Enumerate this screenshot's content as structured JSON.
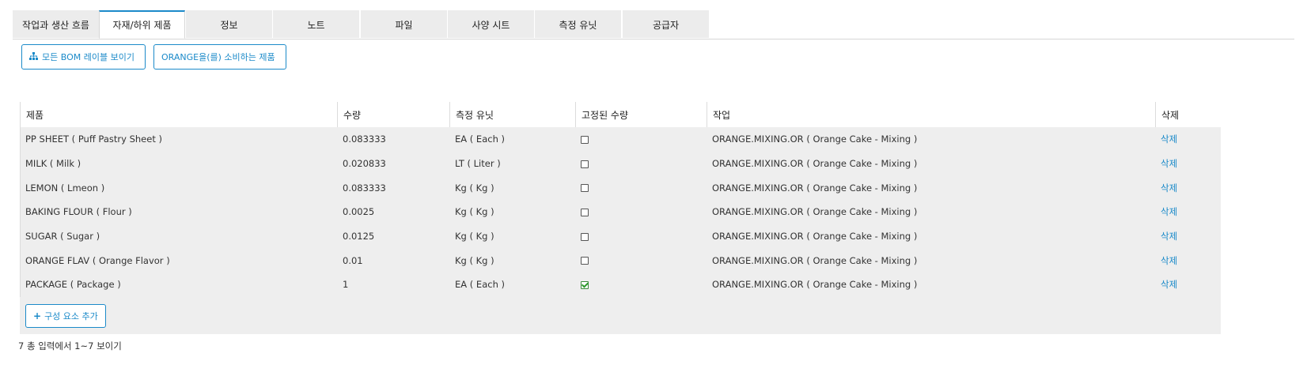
{
  "tabs": [
    {
      "label": "작업과 생산 흐름",
      "active": false
    },
    {
      "label": "자재/하위 제품",
      "active": true
    },
    {
      "label": "정보",
      "active": false
    },
    {
      "label": "노트",
      "active": false
    },
    {
      "label": "파일",
      "active": false
    },
    {
      "label": "사양 시트",
      "active": false
    },
    {
      "label": "측정 유닛",
      "active": false
    },
    {
      "label": "공급자",
      "active": false
    }
  ],
  "actions": {
    "show_bom_icon": "sitemap-icon",
    "show_bom_label": "모든 BOM 레이블 보이기",
    "consumers_label": "ORANGE을(를) 소비하는 제품"
  },
  "table": {
    "headers": {
      "product": "제품",
      "quantity": "수량",
      "uom": "측정 유닛",
      "fixed_qty": "고정된 수량",
      "operation": "작업",
      "delete": "삭제"
    },
    "rows": [
      {
        "product": "PP SHEET ( Puff Pastry Sheet )",
        "quantity": "0.083333",
        "uom": "EA ( Each )",
        "fixed": false,
        "operation": "ORANGE.MIXING.OR ( Orange Cake - Mixing )",
        "delete": "삭제"
      },
      {
        "product": "MILK ( Milk )",
        "quantity": "0.020833",
        "uom": "LT ( Liter )",
        "fixed": false,
        "operation": "ORANGE.MIXING.OR ( Orange Cake - Mixing )",
        "delete": "삭제"
      },
      {
        "product": "LEMON ( Lmeon )",
        "quantity": "0.083333",
        "uom": "Kg ( Kg )",
        "fixed": false,
        "operation": "ORANGE.MIXING.OR ( Orange Cake - Mixing )",
        "delete": "삭제"
      },
      {
        "product": "BAKING FLOUR ( Flour )",
        "quantity": "0.0025",
        "uom": "Kg ( Kg )",
        "fixed": false,
        "operation": "ORANGE.MIXING.OR ( Orange Cake - Mixing )",
        "delete": "삭제"
      },
      {
        "product": "SUGAR ( Sugar )",
        "quantity": "0.0125",
        "uom": "Kg ( Kg )",
        "fixed": false,
        "operation": "ORANGE.MIXING.OR ( Orange Cake - Mixing )",
        "delete": "삭제"
      },
      {
        "product": "ORANGE FLAV ( Orange Flavor )",
        "quantity": "0.01",
        "uom": "Kg ( Kg )",
        "fixed": false,
        "operation": "ORANGE.MIXING.OR ( Orange Cake - Mixing )",
        "delete": "삭제"
      },
      {
        "product": "PACKAGE ( Package )",
        "quantity": "1",
        "uom": "EA ( Each )",
        "fixed": true,
        "operation": "ORANGE.MIXING.OR ( Orange Cake - Mixing )",
        "delete": "삭제"
      }
    ],
    "add_component_icon": "plus-icon",
    "add_component_label": "구성 요소 추가"
  },
  "footer": {
    "summary": "7 총 입력에서 1~7 보이기"
  },
  "colors": {
    "accent": "#1b8ac9",
    "grid_background": "#eeeeee",
    "checkbox_checked": "#2e9a2e"
  }
}
